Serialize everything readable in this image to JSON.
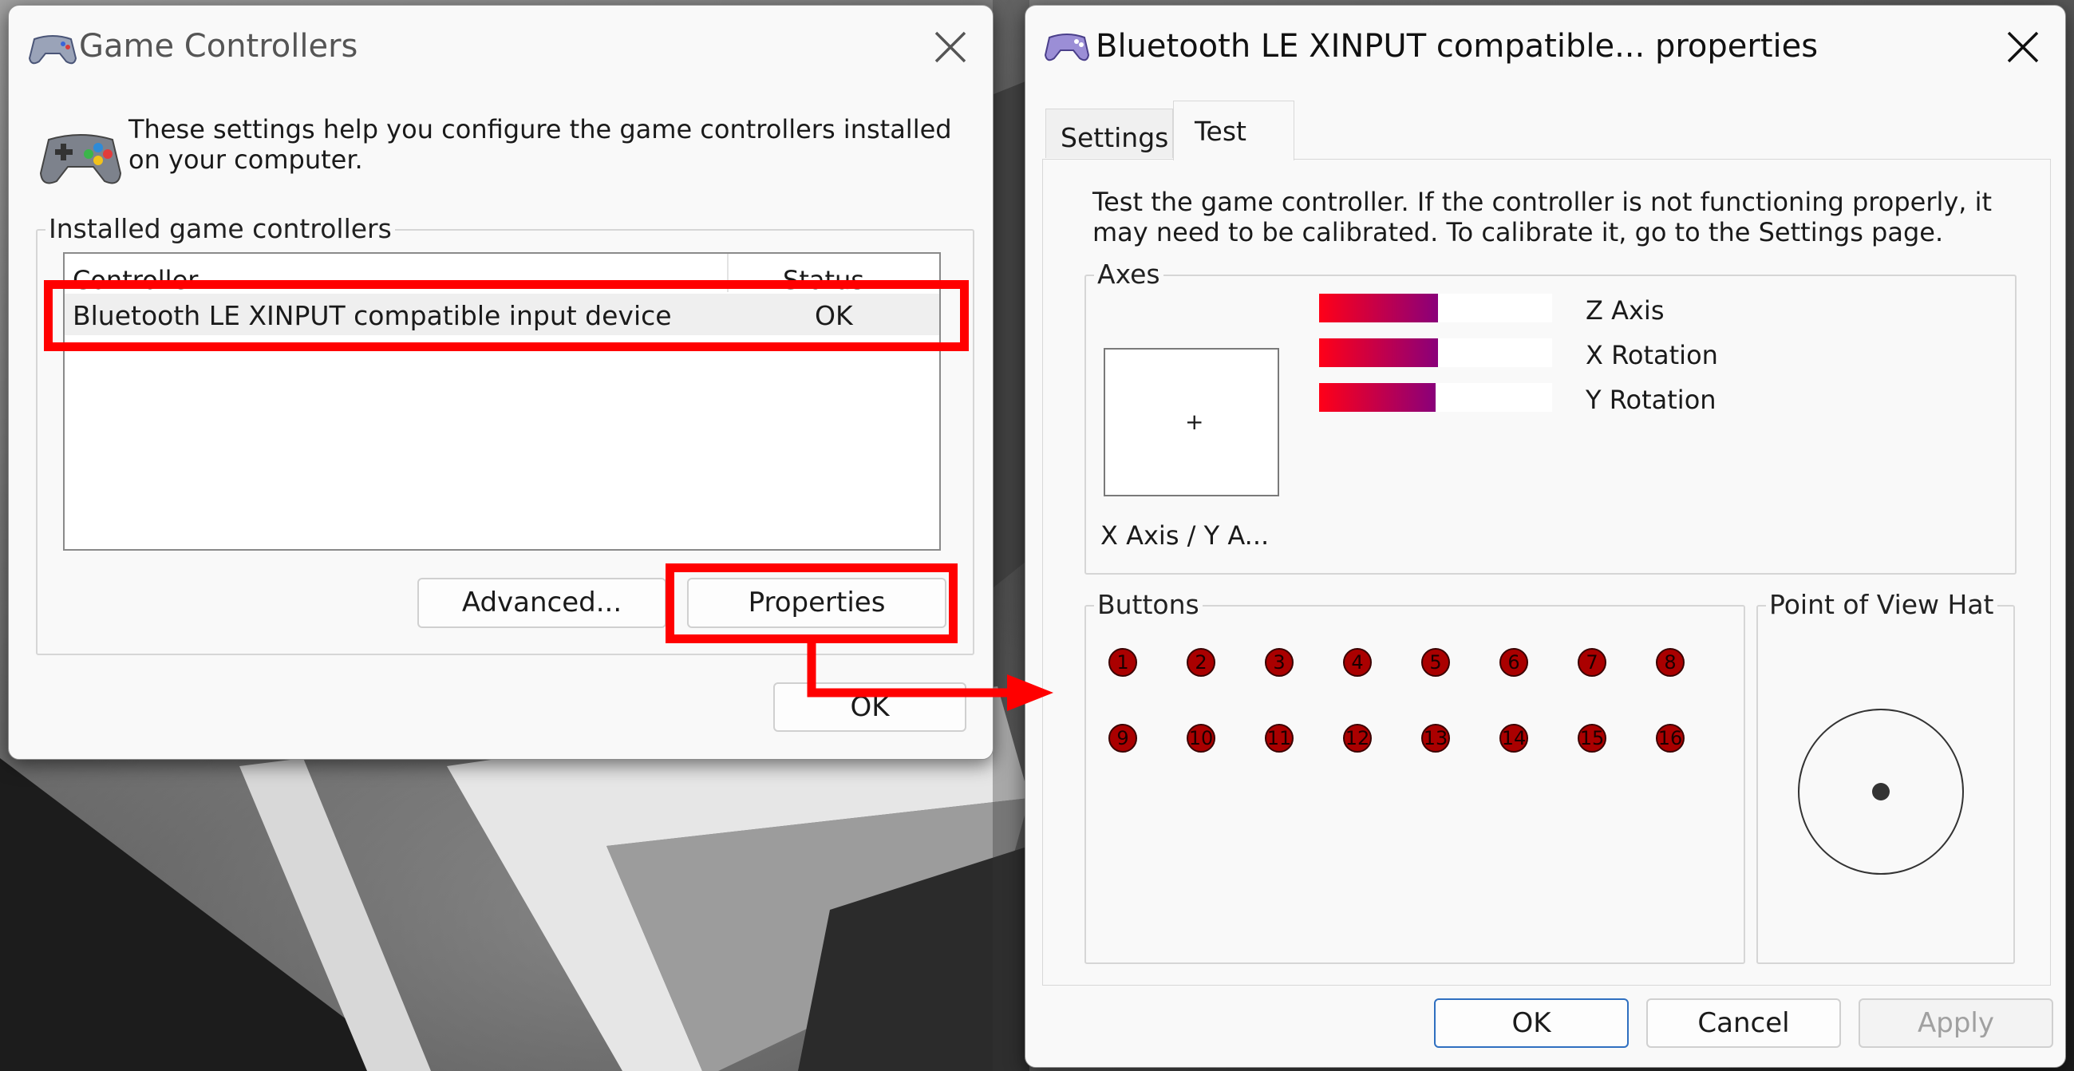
{
  "game_controllers": {
    "title": "Game Controllers",
    "intro_line1": "These settings help you configure the game controllers installed",
    "intro_line2": "on your computer.",
    "group_label": "Installed game controllers",
    "columns": {
      "controller": "Controller",
      "status": "Status"
    },
    "rows": [
      {
        "controller": "Bluetooth LE XINPUT compatible input device",
        "status": "OK"
      }
    ],
    "advanced_label": "Advanced...",
    "properties_label": "Properties",
    "ok_label": "OK"
  },
  "properties": {
    "title": "Bluetooth LE XINPUT compatible... properties",
    "tabs": [
      {
        "label": "Settings"
      },
      {
        "label": "Test"
      }
    ],
    "active_tab": "Test",
    "desc_line1": "Test the game controller.  If the controller is not functioning properly, it",
    "desc_line2": "may need to be calibrated.  To calibrate it, go to the Settings page.",
    "axes_label": "Axes",
    "axes": [
      {
        "label": "Z Axis",
        "value": 0.51
      },
      {
        "label": "X Rotation",
        "value": 0.51
      },
      {
        "label": "Y Rotation",
        "value": 0.5
      }
    ],
    "xy_label": "X Axis / Y A...",
    "xy_crosshair": "+",
    "buttons_label": "Buttons",
    "buttons": [
      "1",
      "2",
      "3",
      "4",
      "5",
      "6",
      "7",
      "8",
      "9",
      "10",
      "11",
      "12",
      "13",
      "14",
      "15",
      "16"
    ],
    "pov_label": "Point of View Hat",
    "ok_label": "OK",
    "cancel_label": "Cancel",
    "apply_label": "Apply"
  },
  "colors": {
    "highlight": "#ff0000",
    "axis_start": "#ff0018",
    "axis_end": "#8a007a",
    "button_dot": "#aa0000"
  }
}
